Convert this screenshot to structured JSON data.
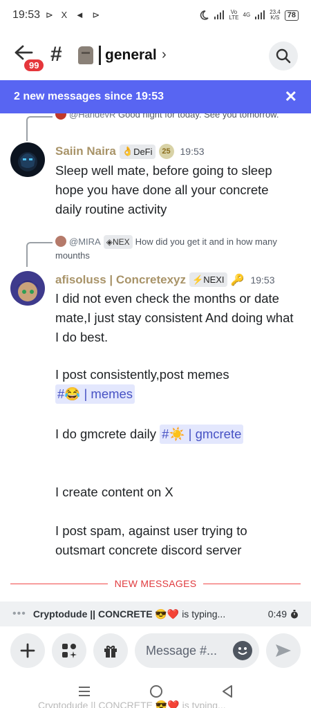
{
  "status_bar": {
    "time": "19:53",
    "left_icons": "⊳ X ◄ ⊳",
    "volte_top": "Vo",
    "volte_bottom": "LTE",
    "net_top": "4G",
    "speed_top": "23.4",
    "speed_bottom": "K/S",
    "battery": "78"
  },
  "header": {
    "back_badge": "99",
    "channel_name": "general",
    "chevron": "›"
  },
  "banner": {
    "text": "2 new messages since 19:53",
    "close": "✕"
  },
  "messages": [
    {
      "reply_author": "@HaridevR",
      "reply_text": "Good night for today. See you tomorrow.",
      "author": "Saiin Naira",
      "role_tag": "DeFi",
      "role_icon": "👌",
      "level": "25",
      "time": "19:53",
      "text": "Sleep well mate, before going to sleep hope you have done all your concrete daily routine activity"
    },
    {
      "reply_author": "@MIRA",
      "reply_tag": "NEX",
      "reply_text": "How did you get it and in how many mounths",
      "author": "afisoluss | Concretexyz",
      "role_tag": "NEXI",
      "role_icon": "⚡",
      "key_icon": "🔑",
      "time": "19:53",
      "paragraphs": {
        "p1": "I did not even check the months or date mate,I just stay consistent And doing what I do best.",
        "p2_prefix": "I post consistently,post memes ",
        "p2_chip": "#😂 | memes",
        "p3_prefix": "I do gmcrete daily ",
        "p3_chip": "#☀️ | gmcrete",
        "p4": "I create content on X",
        "p5": "I post spam, against user trying to outsmart concrete discord server"
      }
    }
  ],
  "divider_label": "NEW MESSAGES",
  "typing": {
    "dots": "•••",
    "user": "Cryptodude || CONCRETE 😎❤️",
    "suffix": "is typing...",
    "countdown": "0:49"
  },
  "composer": {
    "placeholder": "Message #..."
  },
  "ghost_text": "Cryptodude || CONCRETE 😎❤️ is typing..."
}
